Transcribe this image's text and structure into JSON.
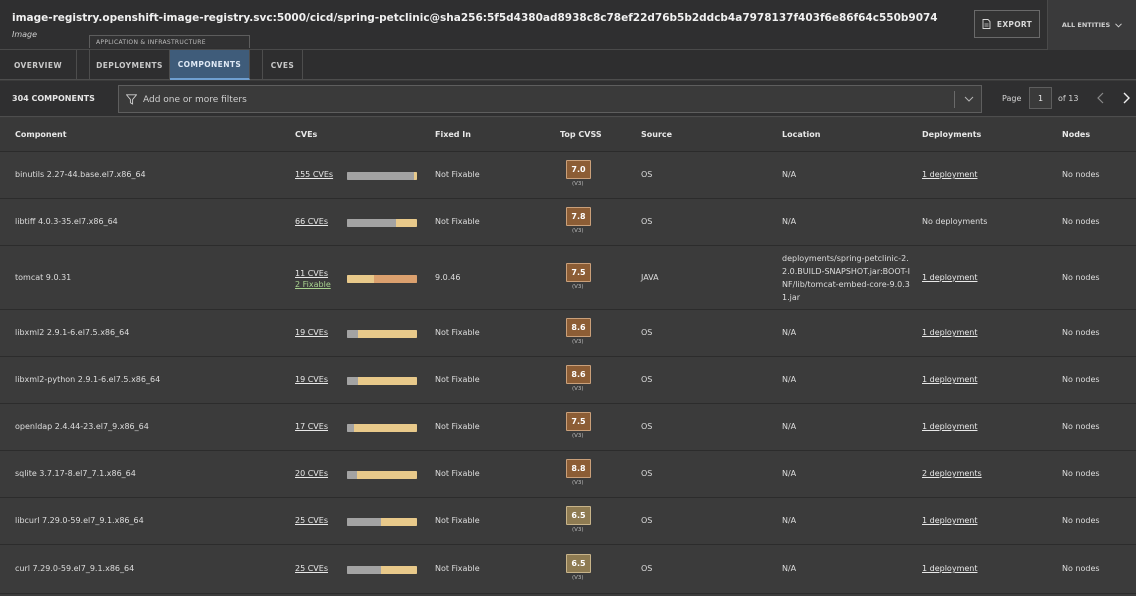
{
  "header": {
    "title": "image-registry.openshift-image-registry.svc:5000/cicd/spring-petclinic@sha256:5f5d4380ad8938c8c78ef22d76b5b2ddcb4a7978137f403f6e86f64c550b9074",
    "subtitle": "Image",
    "export_label": "EXPORT",
    "entities_label": "ALL ENTITIES"
  },
  "tabs": {
    "group_label": "APPLICATION & INFRASTRUCTURE",
    "items": [
      {
        "label": "OVERVIEW"
      },
      {
        "label": "DEPLOYMENTS"
      },
      {
        "label": "COMPONENTS"
      },
      {
        "label": "CVES"
      }
    ],
    "active": "COMPONENTS"
  },
  "filterbar": {
    "count_label": "304 COMPONENTS",
    "placeholder": "Add one or more filters",
    "page_label": "Page",
    "page_value": "1",
    "page_of": "of 13"
  },
  "columns": {
    "component": "Component",
    "cves": "CVEs",
    "fixed_in": "Fixed In",
    "top_cvss": "Top CVSS",
    "source": "Source",
    "location": "Location",
    "deployments": "Deployments",
    "nodes": "Nodes"
  },
  "colors": {
    "low": "#a3a3a3",
    "medium": "#e8c98a",
    "high": "#dba06e",
    "cvss_high": "#8c5d35",
    "cvss_med": "#8e7b52"
  },
  "rows": [
    {
      "component": "binutils 2.27-44.base.el7.x86_64",
      "cves": "155 CVEs",
      "fixable": "",
      "fixed_in": "Not Fixable",
      "cvss": "7.0",
      "cvss_ver": "(V3)",
      "source": "OS",
      "location": "N/A",
      "deployments": "1 deployment",
      "nodes": "No nodes",
      "sev": {
        "low": 0.96,
        "medium": 0.04,
        "high": 0
      }
    },
    {
      "component": "libtiff 4.0.3-35.el7.x86_64",
      "cves": "66 CVEs",
      "fixable": "",
      "fixed_in": "Not Fixable",
      "cvss": "7.8",
      "cvss_ver": "(V3)",
      "source": "OS",
      "location": "N/A",
      "deployments": "No deployments",
      "nodes": "No nodes",
      "sev": {
        "low": 0.7,
        "medium": 0.3,
        "high": 0
      }
    },
    {
      "component": "tomcat 9.0.31",
      "cves": "11 CVEs",
      "fixable": "2 Fixable",
      "fixed_in": "9.0.46",
      "cvss": "7.5",
      "cvss_ver": "(V3)",
      "source": "JAVA",
      "location": "deployments/spring-petclinic-2.2.0.BUILD-SNAPSHOT.jar:BOOT-INF/lib/tomcat-embed-core-9.0.31.jar",
      "deployments": "1 deployment",
      "nodes": "No nodes",
      "sev": {
        "low": 0,
        "medium": 0.38,
        "high": 0.62
      }
    },
    {
      "component": "libxml2 2.9.1-6.el7.5.x86_64",
      "cves": "19 CVEs",
      "fixable": "",
      "fixed_in": "Not Fixable",
      "cvss": "8.6",
      "cvss_ver": "(V3)",
      "source": "OS",
      "location": "N/A",
      "deployments": "1 deployment",
      "nodes": "No nodes",
      "sev": {
        "low": 0.16,
        "medium": 0.84,
        "high": 0
      }
    },
    {
      "component": "libxml2-python 2.9.1-6.el7.5.x86_64",
      "cves": "19 CVEs",
      "fixable": "",
      "fixed_in": "Not Fixable",
      "cvss": "8.6",
      "cvss_ver": "(V3)",
      "source": "OS",
      "location": "N/A",
      "deployments": "1 deployment",
      "nodes": "No nodes",
      "sev": {
        "low": 0.16,
        "medium": 0.84,
        "high": 0
      }
    },
    {
      "component": "openldap 2.4.44-23.el7_9.x86_64",
      "cves": "17 CVEs",
      "fixable": "",
      "fixed_in": "Not Fixable",
      "cvss": "7.5",
      "cvss_ver": "(V3)",
      "source": "OS",
      "location": "N/A",
      "deployments": "1 deployment",
      "nodes": "No nodes",
      "sev": {
        "low": 0.1,
        "medium": 0.9,
        "high": 0
      }
    },
    {
      "component": "sqlite 3.7.17-8.el7_7.1.x86_64",
      "cves": "20 CVEs",
      "fixable": "",
      "fixed_in": "Not Fixable",
      "cvss": "8.8",
      "cvss_ver": "(V3)",
      "source": "OS",
      "location": "N/A",
      "deployments": "2 deployments",
      "nodes": "No nodes",
      "sev": {
        "low": 0.14,
        "medium": 0.86,
        "high": 0
      }
    },
    {
      "component": "libcurl 7.29.0-59.el7_9.1.x86_64",
      "cves": "25 CVEs",
      "fixable": "",
      "fixed_in": "Not Fixable",
      "cvss": "6.5",
      "cvss_ver": "(V3)",
      "source": "OS",
      "location": "N/A",
      "deployments": "1 deployment",
      "nodes": "No nodes",
      "sev": {
        "low": 0.48,
        "medium": 0.52,
        "high": 0
      }
    },
    {
      "component": "curl 7.29.0-59.el7_9.1.x86_64",
      "cves": "25 CVEs",
      "fixable": "",
      "fixed_in": "Not Fixable",
      "cvss": "6.5",
      "cvss_ver": "(V3)",
      "source": "OS",
      "location": "N/A",
      "deployments": "1 deployment",
      "nodes": "No nodes",
      "sev": {
        "low": 0.48,
        "medium": 0.52,
        "high": 0
      }
    }
  ]
}
